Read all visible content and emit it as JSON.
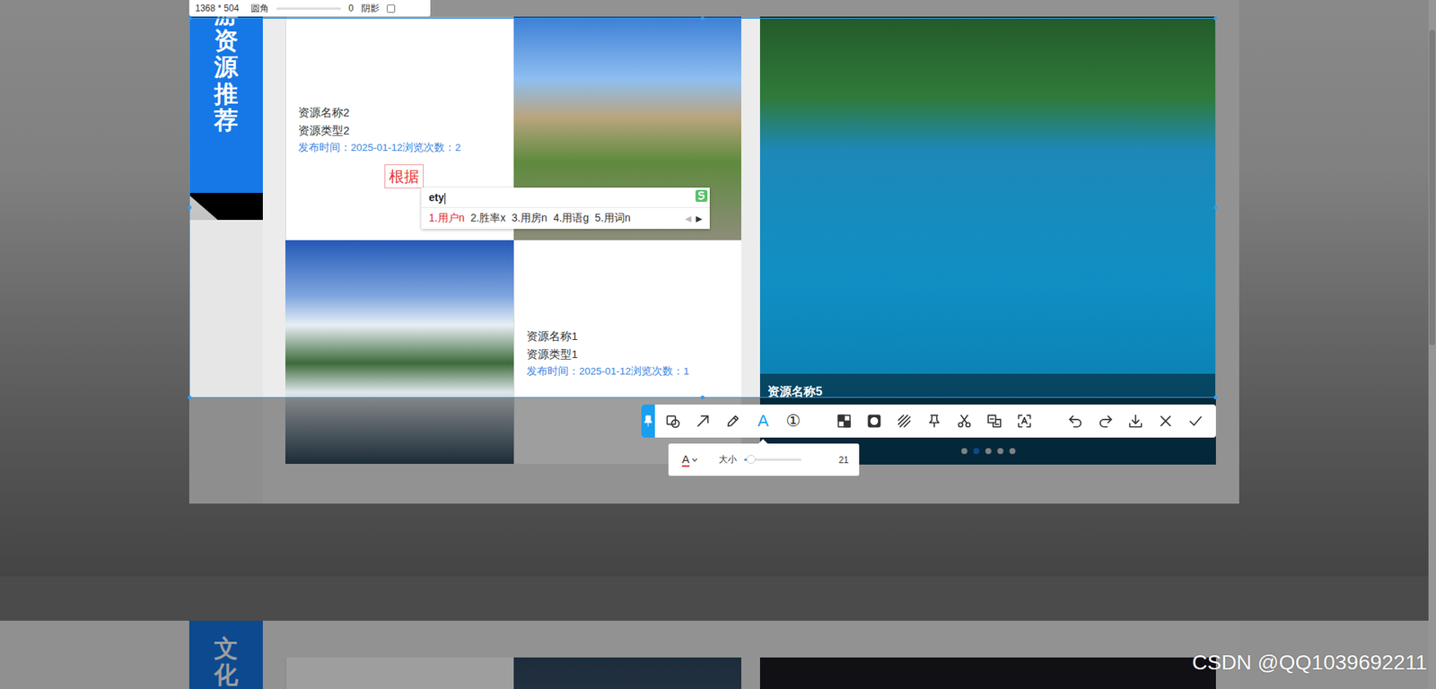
{
  "page": {
    "sections": [
      {
        "title": "游资源推荐",
        "cards": [
          {
            "kind": "text",
            "name": "资源名称2",
            "type": "资源类型2",
            "meta": "发布时间：2025-01-12浏览次数：2"
          },
          {
            "kind": "photo"
          },
          {
            "kind": "photo"
          },
          {
            "kind": "text",
            "name": "资源名称1",
            "type": "资源类型1",
            "meta": "发布时间：2025-01-12浏览次数：1"
          }
        ],
        "feature": {
          "caption": "资源名称5",
          "dots": [
            {
              "selected": false
            },
            {
              "selected": true
            },
            {
              "selected": false
            },
            {
              "selected": false
            },
            {
              "selected": false
            }
          ]
        }
      },
      {
        "title": "文化",
        "cards": [
          {
            "kind": "text",
            "name": "",
            "type": "",
            "meta": ""
          },
          {
            "kind": "photo"
          }
        ],
        "feature": {
          "caption": "",
          "dots": []
        }
      }
    ],
    "watermark": "CSDN @QQ1039692211"
  },
  "capture": {
    "size": "1368 * 504",
    "radius_label": "圆角",
    "radius_value": "0",
    "radius_level": 0,
    "shadow_label": "阴影",
    "shadow_checked": false,
    "annotation": "根据",
    "ime": {
      "input": "ety",
      "candidates": [
        {
          "label": "1.用户n",
          "selected": true
        },
        {
          "label": "2.胜率x",
          "selected": false
        },
        {
          "label": "3.用房n",
          "selected": false
        },
        {
          "label": "4.用语g",
          "selected": false
        },
        {
          "label": "5.用词n",
          "selected": false
        }
      ],
      "prev": "◀",
      "prev_disabled": true,
      "next": "▶"
    },
    "toolbar": {
      "groups": [
        [
          {
            "kind": "shape",
            "selected": false
          },
          {
            "kind": "arrow",
            "selected": false
          },
          {
            "kind": "pencil",
            "selected": false
          },
          {
            "kind": "glyph",
            "glyph": "A",
            "selected": true
          },
          {
            "kind": "glyph",
            "glyph": "①",
            "selected": false
          }
        ],
        [
          {
            "kind": "mosaic",
            "selected": false
          },
          {
            "kind": "blur",
            "selected": false
          },
          {
            "kind": "hatch",
            "selected": false
          },
          {
            "kind": "pin",
            "selected": false
          },
          {
            "kind": "scissors",
            "selected": false
          },
          {
            "kind": "translate",
            "selected": false
          },
          {
            "kind": "ocr",
            "selected": false
          }
        ],
        [
          {
            "kind": "undo",
            "selected": false
          },
          {
            "kind": "redo",
            "selected": false
          },
          {
            "kind": "download",
            "selected": false
          },
          {
            "kind": "close",
            "selected": false
          },
          {
            "kind": "confirm",
            "selected": false
          }
        ]
      ]
    },
    "text_options": {
      "color_glyph": "A",
      "size_label": "大小",
      "size_level": 0.12,
      "size_value": "21"
    }
  }
}
